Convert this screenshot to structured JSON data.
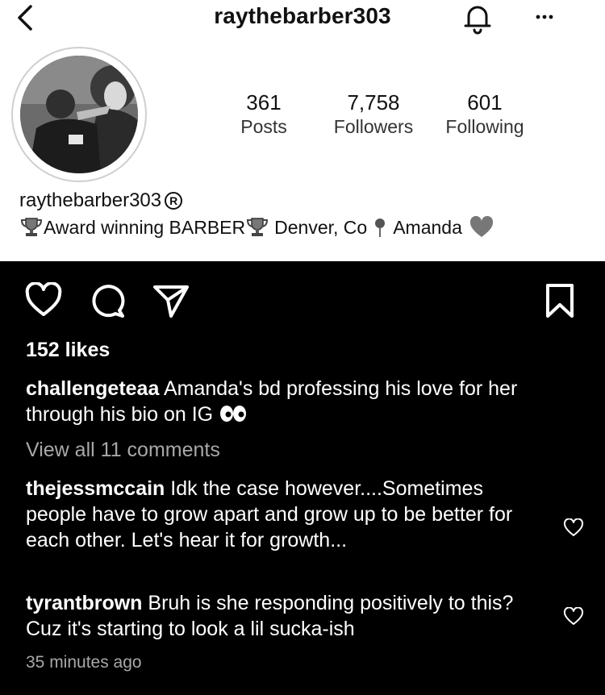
{
  "profile": {
    "header_username": "raythebarber303",
    "stats": [
      {
        "value": "361",
        "label": "Posts"
      },
      {
        "value": "7,758",
        "label": "Followers"
      },
      {
        "value": "601",
        "label": "Following"
      }
    ],
    "display_name": "raythebarber303",
    "bio": {
      "part1": "Award winning BARBER",
      "part2": "Denver, Co",
      "part3": "Amanda"
    }
  },
  "post": {
    "likes": "152 likes",
    "caption": {
      "username": "challengeteaa",
      "text": "Amanda's bd professing his love for her through his bio on IG"
    },
    "view_all": "View all 11 comments",
    "comments": [
      {
        "username": "thejessmccain",
        "text": "Idk the case however....Sometimes people have to grow apart and grow up to be better for each other. Let's hear it for growth..."
      },
      {
        "username": "tyrantbrown",
        "text": "Bruh is she responding positively to this? Cuz it's starting to look a lil sucka-ish"
      }
    ],
    "timestamp": "35 minutes ago"
  },
  "icons": {
    "back": "chevron-left-icon",
    "bell": "bell-icon",
    "more": "more-icon",
    "trophy": "trophy-icon",
    "pin": "pin-icon",
    "gray_heart": "gray-heart-icon",
    "eyes": "eyes-icon",
    "like": "heart-icon",
    "comment": "comment-icon",
    "share": "share-icon",
    "save": "bookmark-icon"
  }
}
